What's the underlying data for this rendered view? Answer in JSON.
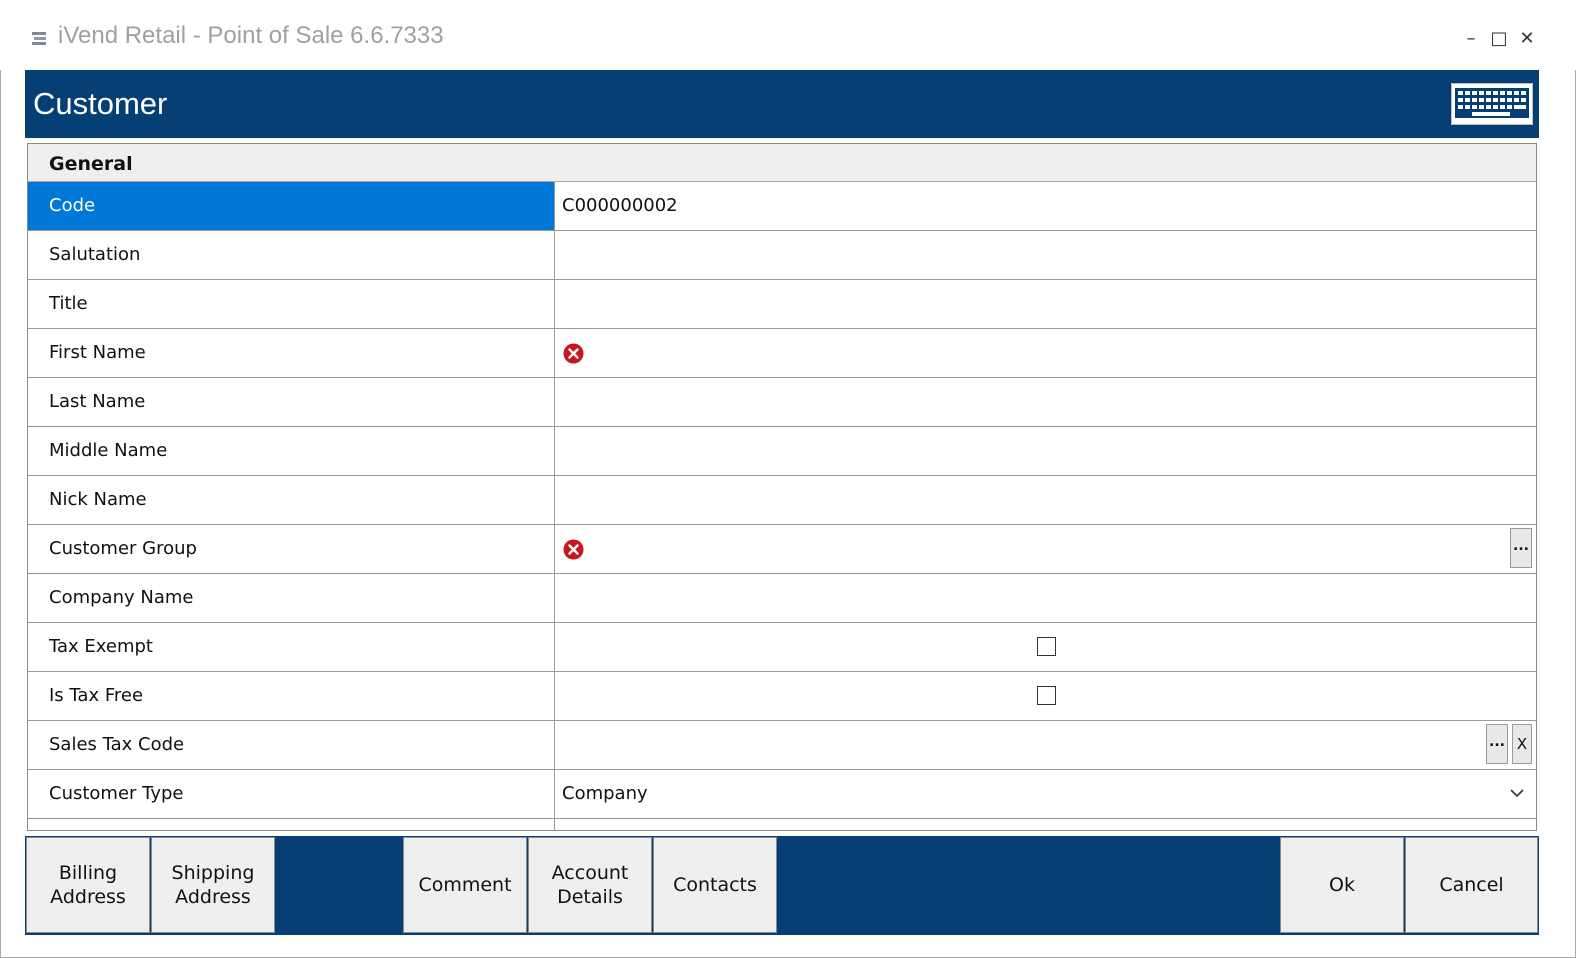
{
  "window": {
    "title": "iVend Retail - Point of Sale 6.6.7333",
    "controls": {
      "minimize": "–",
      "maximize": "□",
      "close": "✕"
    }
  },
  "header": {
    "title": "Customer",
    "keyboard_icon": "keyboard-icon",
    "bg_color": "#063f76"
  },
  "section": {
    "label": "General"
  },
  "rows": [
    {
      "label": "Code",
      "value": "C000000002",
      "selected": true
    },
    {
      "label": "Salutation",
      "value": ""
    },
    {
      "label": "Title",
      "value": ""
    },
    {
      "label": "First Name",
      "value": "",
      "error": true
    },
    {
      "label": "Last Name",
      "value": ""
    },
    {
      "label": "Middle Name",
      "value": ""
    },
    {
      "label": "Nick Name",
      "value": ""
    },
    {
      "label": "Customer Group",
      "value": "",
      "error": true,
      "lookup_label": "..."
    },
    {
      "label": "Company Name",
      "value": ""
    },
    {
      "label": "Tax Exempt",
      "checked": false
    },
    {
      "label": "Is Tax Free",
      "checked": false
    },
    {
      "label": "Sales Tax Code",
      "value": "",
      "lookup_label": "...",
      "clear_label": "X"
    },
    {
      "label": "Customer Type",
      "value": "Company",
      "dropdown": true
    }
  ],
  "footer": {
    "billing_address": "Billing\nAddress",
    "shipping_address": "Shipping\nAddress",
    "comment": "Comment",
    "account_details": "Account\nDetails",
    "contacts": "Contacts",
    "ok": "Ok",
    "cancel": "Cancel"
  },
  "colors": {
    "selected_row": "#0078d7",
    "error": "#c8161d"
  }
}
